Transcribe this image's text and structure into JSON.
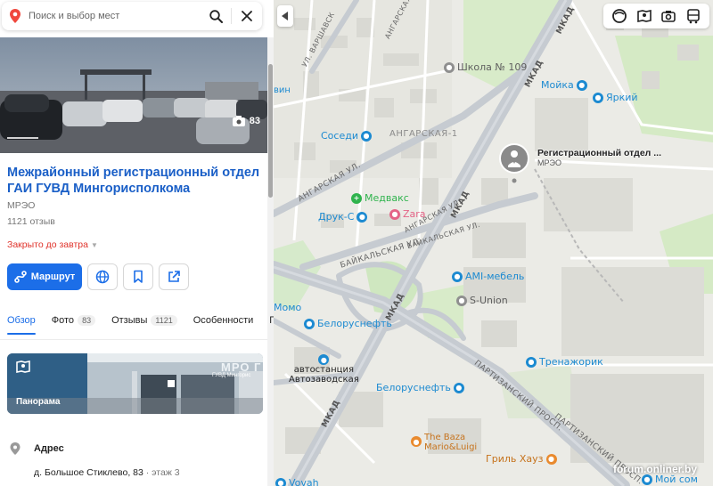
{
  "search": {
    "placeholder": "Поиск и выбор мест"
  },
  "panel": {
    "photo_count": "83",
    "title": "Межрайонный регистрационный отдел ГАИ ГУВД Мингорисполкома",
    "subtitle": "МРЭО",
    "reviews": "1121 отзыв",
    "status": "Закрыто до завтра",
    "route_label": "Маршрут",
    "tabs": [
      {
        "label": "Обзор",
        "badge": ""
      },
      {
        "label": "Фото",
        "badge": "83"
      },
      {
        "label": "Отзывы",
        "badge": "1121"
      },
      {
        "label": "Особенности",
        "badge": ""
      },
      {
        "label": "По",
        "badge": ""
      }
    ],
    "panorama_label": "Панорама",
    "panorama_sign": "МРО Г",
    "panorama_sign2": "ГУВД Мингорис",
    "address_label": "Адрес",
    "address_value": "д. Большое Стиклево, 83",
    "address_floor": " · этаж 3"
  },
  "map": {
    "place_name": "Регистрационный отдел ...",
    "place_type": "МРЭО",
    "labels": {
      "school": "Школа № 109",
      "moika": "Мойка",
      "yarkiy": "Яркий",
      "sosedi": "Соседи",
      "angarskaya1": "АНГАРСКАЯ-1",
      "medvaks": "Медвакс",
      "druks": "Друк-С",
      "zara": "Zara",
      "ami": "AMI-мебель",
      "sunion": "S-Union",
      "belor1": "Белоруснефть",
      "avtostanciya": "автостанция",
      "avtozavodskaya": "Автозаводская",
      "belor2": "Белоруснефть",
      "trenazhorik": "Тренажорик",
      "thebaza1": "The Baza",
      "thebaza2": "Mario&Luigi",
      "grill": "Гриль Хауз",
      "moi_som": "Мой сом",
      "vovah": "Vovah",
      "momo": "Момо",
      "vin": "вин"
    },
    "roads": {
      "mkad_top": "МКАД",
      "mkad_mid": "МКАД",
      "mkad_low": "МКАД",
      "mkad_bottom": "МКАД",
      "mkad_right": "МКАД",
      "angarskaya_ul": "АНГАРСКАЯ УЛ.",
      "angarskaya_ul2": "АНГАРСКАЯ УЛ.",
      "angarskaya_top": "АНГАРСКАЯ",
      "varshavskaya": "УЛ. ВАРШАВСК",
      "baikalskaya": "БАЙКАЛЬСКАЯ УЛ.",
      "baikalskaya2": "БАЙКАЛЬСКАЯ УЛ.",
      "partizanskiy": "ПАРТИЗАНСКИЙ ПРОСП.",
      "partizanskiy2": "ПАРТИЗАНСКИЙ ПРОСП."
    },
    "watermark": "forum.onliner.by"
  },
  "colors": {
    "accent": "#1c6ee8",
    "title": "#1a5fc7",
    "closed": "#e0332b",
    "medical": "#2fb34d",
    "shop": "#e46487",
    "pin": "#f0483e"
  }
}
